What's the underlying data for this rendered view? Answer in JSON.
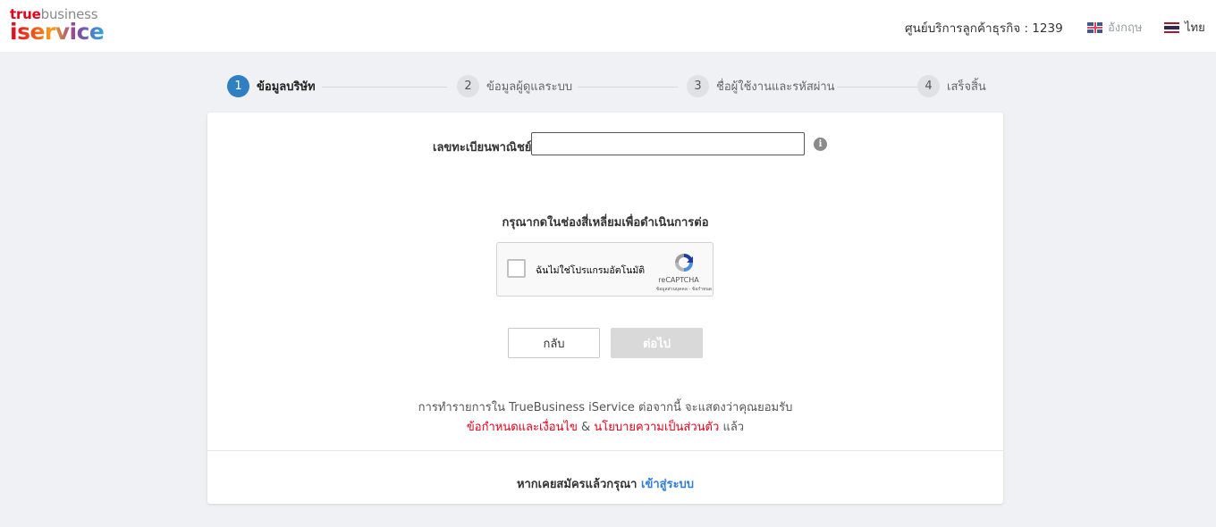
{
  "header": {
    "logo_top_red": "true",
    "logo_top_gray": "business",
    "logo_bottom": "iservice",
    "hotline": "ศูนย์บริการลูกค้าธุรกิจ : 1239",
    "lang_en": "อังกฤษ",
    "lang_th": "ไทย",
    "lang_en_flag_icon": "uk-flag-icon",
    "lang_th_flag_icon": "thai-flag-icon"
  },
  "stepper": {
    "steps": [
      {
        "number": "1",
        "label": "ข้อมูลบริษัท",
        "active": true
      },
      {
        "number": "2",
        "label": "ข้อมูลผู้ดูแลระบบ",
        "active": false
      },
      {
        "number": "3",
        "label": "ชื่อผู้ใช้งานและรหัสผ่าน",
        "active": false
      },
      {
        "number": "4",
        "label": "เสร็จสิ้น",
        "active": false
      }
    ]
  },
  "form": {
    "registration_label": "เลขทะเบียนพาณิชย์",
    "registration_value": "",
    "info_icon": "info-icon",
    "captcha_instruction": "กรุณากดในช่องสี่เหลี่ยมเพื่อดำเนินการต่อ",
    "recaptcha": {
      "label": "ฉันไม่ใช่โปรแกรมอัตโนมัติ",
      "brand": "reCAPTCHA",
      "terms": "ข้อมูลส่วนบุคคล - ข้อกำหนด"
    },
    "back_label": "กลับ",
    "next_label": "ต่อไป"
  },
  "terms": {
    "line1": "การทำรายการใน TrueBusiness iService ต่อจากนี้ จะแสดงว่าคุณยอมรับ",
    "terms_link": "ข้อกำหนดและเงื่อนไข",
    "amp": "&",
    "privacy_link": "นโยบายความเป็นส่วนตัว",
    "suffix": "แล้ว"
  },
  "footer": {
    "prompt": "หากเคยสมัครแล้วกรุณา",
    "login_link": "เข้าสู่ระบบ"
  },
  "colors": {
    "accent_blue": "#2f7fc1",
    "brand_red": "#e2001a",
    "link_blue": "#2f7fd9",
    "background": "#f0f1f4"
  }
}
